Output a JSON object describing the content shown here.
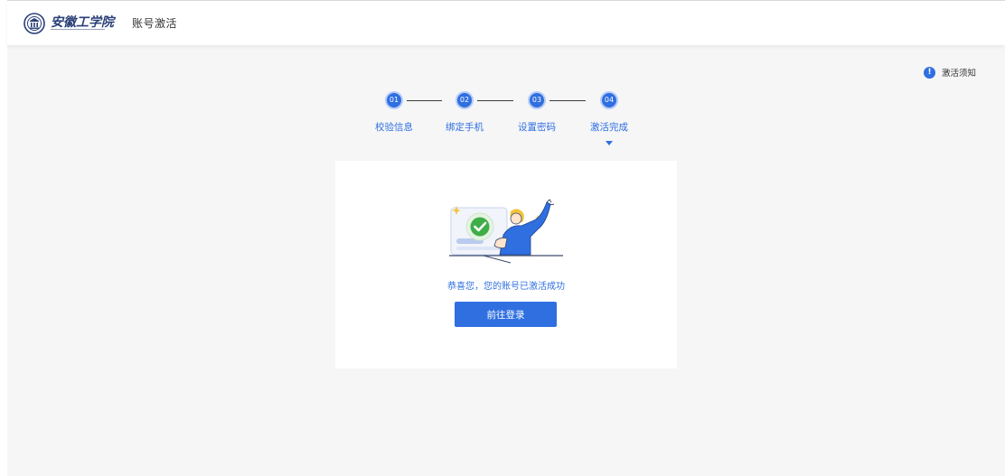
{
  "header": {
    "logo_text": "安徽工学院",
    "title": "账号激活"
  },
  "notice": {
    "icon": "info-icon",
    "label": "激活须知"
  },
  "steps": [
    {
      "number": "01",
      "label": "校验信息"
    },
    {
      "number": "02",
      "label": "绑定手机"
    },
    {
      "number": "03",
      "label": "设置密码"
    },
    {
      "number": "04",
      "label": "激活完成"
    }
  ],
  "current_step": 4,
  "result": {
    "message": "恭喜您，您的账号已激活成功",
    "button_label": "前往登录"
  },
  "colors": {
    "accent": "#2f6fe0",
    "success": "#3fae49",
    "background": "#f6f6f7"
  }
}
